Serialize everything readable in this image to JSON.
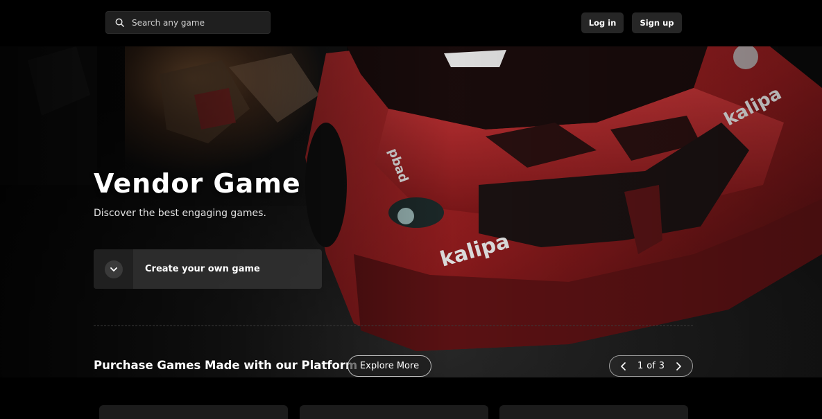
{
  "header": {
    "search_placeholder": "Search any game",
    "login_label": "Log in",
    "signup_label": "Sign up"
  },
  "hero": {
    "title": "Vendor Game",
    "subtitle": "Discover the best engaging games.",
    "create_label": "Create your own game",
    "image_text": [
      "kalipa",
      "kalipa",
      "pbad"
    ]
  },
  "section": {
    "title": "Purchase Games Made with our Platform",
    "explore_label": "Explore More",
    "pager": {
      "current": "1",
      "of": "of",
      "total": "3"
    }
  },
  "colors": {
    "background": "#000000",
    "surface": "#262626",
    "car_red": "#8e1b1d"
  },
  "icons": [
    "search-icon",
    "chevron-down-icon",
    "chevron-left-icon",
    "chevron-right-icon"
  ]
}
